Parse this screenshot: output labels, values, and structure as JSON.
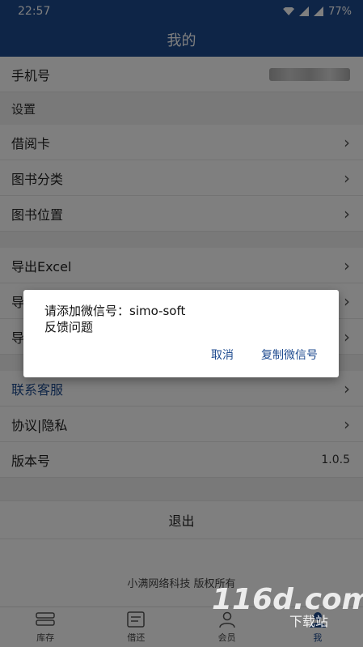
{
  "status": {
    "time": "22:57",
    "battery": "77%"
  },
  "header": {
    "title": "我的"
  },
  "phone": {
    "label": "手机号"
  },
  "settings_label": "设置",
  "settings": [
    {
      "label": "借阅卡"
    },
    {
      "label": "图书分类"
    },
    {
      "label": "图书位置"
    }
  ],
  "export": {
    "label": "导出Excel"
  },
  "partial_rows": [
    {
      "label": "导"
    },
    {
      "label": "导"
    }
  ],
  "support": [
    {
      "label": "联系客服"
    },
    {
      "label": "协议|隐私"
    }
  ],
  "version": {
    "label": "版本号",
    "value": "1.0.5"
  },
  "logout": {
    "label": "退出"
  },
  "copyright": "小满网络科技 版权所有",
  "tabs": [
    {
      "label": "库存"
    },
    {
      "label": "借还"
    },
    {
      "label": "会员"
    },
    {
      "label": "我"
    }
  ],
  "dialog": {
    "line1": "请添加微信号：simo-soft",
    "line2": "反馈问题",
    "cancel": "取消",
    "copy": "复制微信号"
  },
  "watermark": {
    "brand": "116d.com",
    "sub": "下载站"
  },
  "colors": {
    "primary": "#1d4a8f",
    "link": "#1d4a8f",
    "overlay": "rgba(0,0,0,0.5)"
  }
}
